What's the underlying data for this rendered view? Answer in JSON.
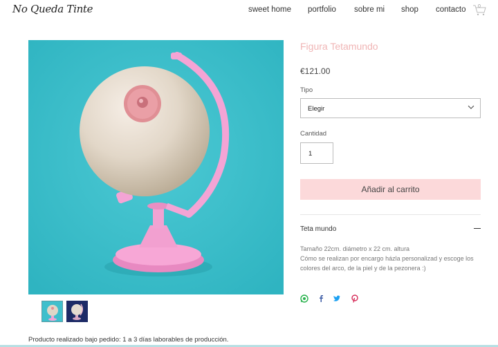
{
  "header": {
    "logo": "No Queda Tinte",
    "nav": [
      "sweet home",
      "portfolio",
      "sobre mi",
      "shop",
      "contacto"
    ],
    "cart_count": "0"
  },
  "product": {
    "title": "Figura Tetamundo",
    "price": "€121.00",
    "tipo_label": "Tipo",
    "tipo_value": "Elegir",
    "cantidad_label": "Cantidad",
    "cantidad_value": "1",
    "add_to_cart": "Añadir al carrito",
    "section_title": "Teta mundo",
    "description": [
      "Tamaño 22cm. diámetro x 22 cm. altura",
      "Cómo se realizan por encargo házla personalizad y  escoge los",
      "colores del arco, de la piel y de la pezonera :)"
    ]
  },
  "share_icons": [
    "whatsapp-icon",
    "facebook-icon",
    "twitter-icon",
    "pinterest-icon"
  ],
  "footer_note": "Producto realizado bajo pedido: 1 a 3 días laborables de producción.",
  "colors": {
    "accent": "#fcd9da",
    "title": "#f0b5b5",
    "image_background": "#3fbfcc"
  }
}
